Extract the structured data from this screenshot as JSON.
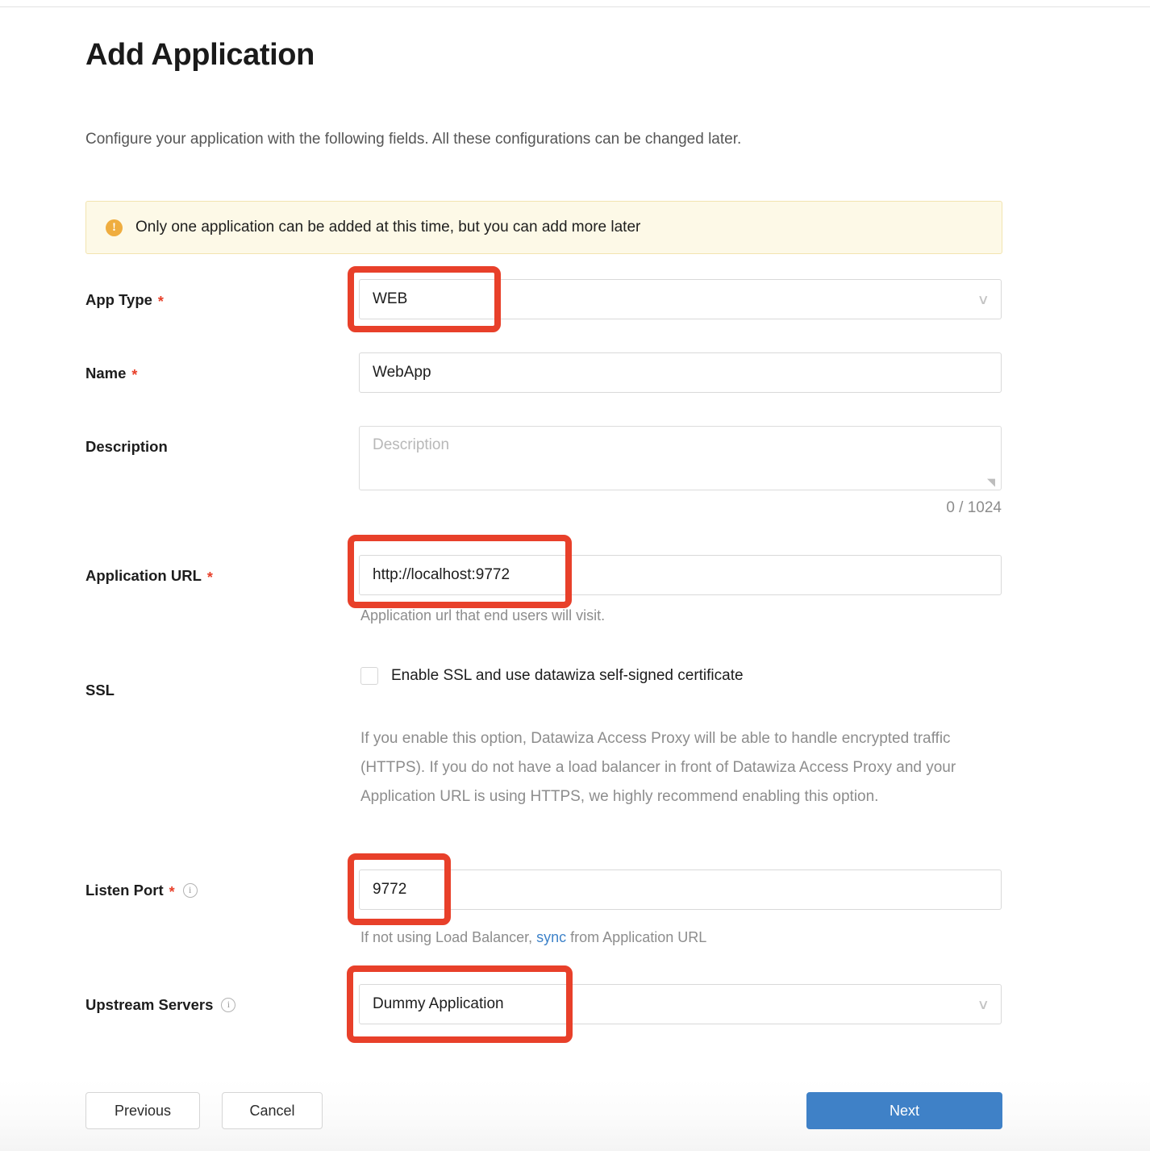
{
  "page": {
    "title": "Add Application",
    "subtitle": "Configure your application with the following fields. All these configurations can be changed later."
  },
  "alert": {
    "icon": "warning-icon",
    "text": "Only one application can be added at this time, but you can add more later",
    "background": "#fdf9e7",
    "border": "#f2e4b0",
    "icon_color": "#efad3f"
  },
  "form": {
    "app_type": {
      "label": "App Type",
      "required": "*",
      "value": "WEB",
      "chevron": "chevron-down-icon"
    },
    "name": {
      "label": "Name",
      "required": "*",
      "value": "WebApp"
    },
    "description": {
      "label": "Description",
      "placeholder": "Description",
      "value": "",
      "counter": "0 / 1024"
    },
    "application_url": {
      "label": "Application URL",
      "required": "*",
      "value": "http://localhost:9772",
      "hint": "Application url that end users will visit."
    },
    "ssl": {
      "label": "SSL",
      "checkbox_label": "Enable SSL and use datawiza self-signed certificate",
      "checked": false,
      "description": "If you enable this option, Datawiza Access Proxy will be able to handle encrypted traffic (HTTPS). If you do not have a load balancer in front of Datawiza Access Proxy and your Application URL is using HTTPS, we highly recommend enabling this option."
    },
    "listen_port": {
      "label": "Listen Port",
      "required": "*",
      "info": "info-icon",
      "value": "9772",
      "hint_before": "If not using Load Balancer, ",
      "hint_link": "sync",
      "hint_after": " from Application URL",
      "link_color": "#3d82c9"
    },
    "upstream_servers": {
      "label": "Upstream Servers",
      "info": "info-icon",
      "value": "Dummy Application",
      "chevron": "chevron-down-icon"
    }
  },
  "footer": {
    "previous_label": "Previous",
    "cancel_label": "Cancel",
    "next_label": "Next",
    "primary_color": "#3f81c7"
  },
  "annotations": {
    "color": "#e8402a",
    "targets": [
      "app-type-field",
      "application-url-field",
      "listen-port-field",
      "upstream-servers-field"
    ]
  }
}
